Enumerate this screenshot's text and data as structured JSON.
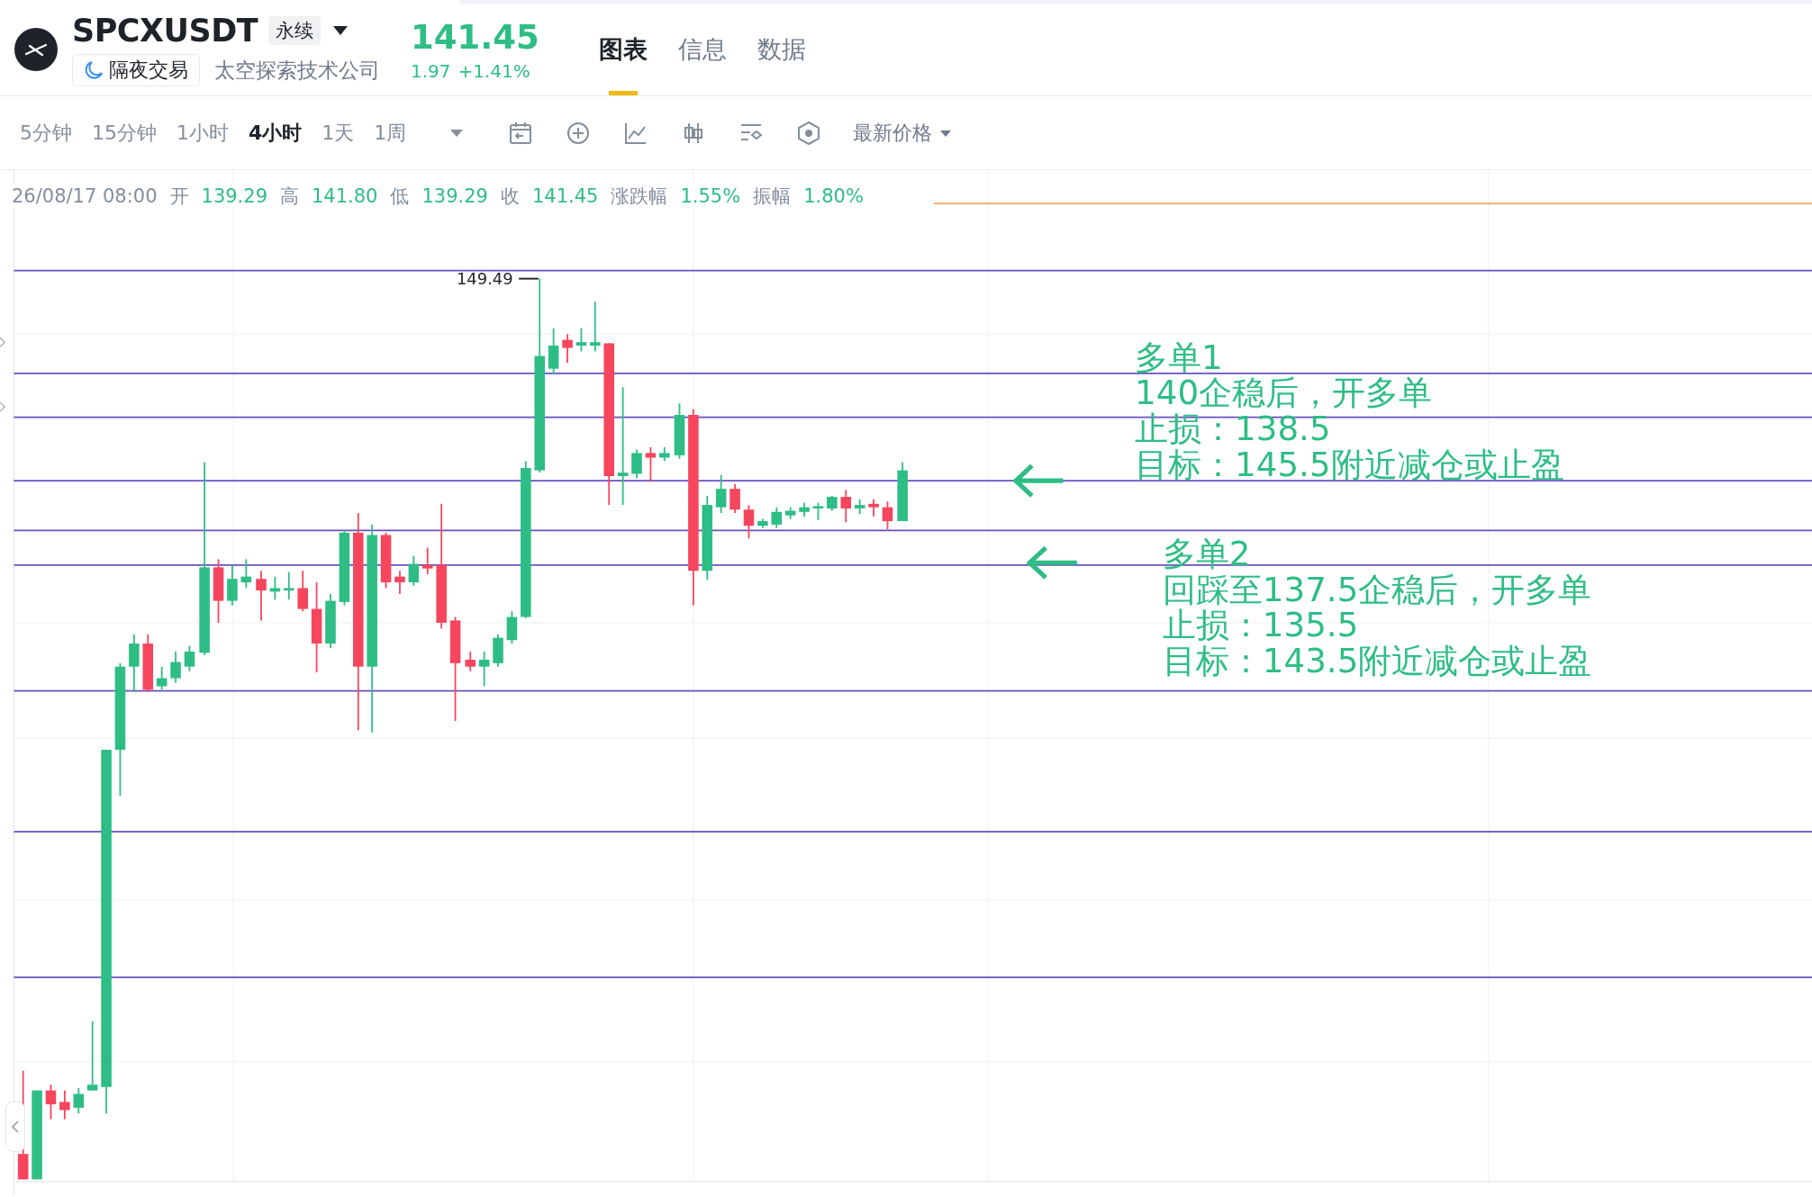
{
  "header": {
    "symbol": "SPCXUSDT",
    "contract_badge": "永续",
    "session_badge": "隔夜交易",
    "company": "太空探索技术公司",
    "price": "141.45",
    "change": "1.97",
    "change_percent": "+1.41%"
  },
  "tabs": [
    {
      "label": "图表",
      "selected": true
    },
    {
      "label": "信息",
      "selected": false
    },
    {
      "label": "数据",
      "selected": false
    }
  ],
  "intervals": [
    {
      "label": "5分钟",
      "selected": false
    },
    {
      "label": "15分钟",
      "selected": false
    },
    {
      "label": "1小时",
      "selected": false
    },
    {
      "label": "4小时",
      "selected": true
    },
    {
      "label": "1天",
      "selected": false
    },
    {
      "label": "1周",
      "selected": false
    }
  ],
  "price_source": "最新价格",
  "ohlc_bar": {
    "time": "26/08/17 08:00",
    "fields": [
      {
        "label": "开",
        "value": "139.29"
      },
      {
        "label": "高",
        "value": "141.80"
      },
      {
        "label": "低",
        "value": "139.29"
      },
      {
        "label": "收",
        "value": "141.45"
      },
      {
        "label": "涨跌幅",
        "value": "1.55%"
      },
      {
        "label": "振幅",
        "value": "1.80%"
      }
    ]
  },
  "chart": {
    "high_label": "149.49",
    "notes": [
      {
        "title": "多单1",
        "lines": [
          "140企稳后，开多单",
          "止损：138.5",
          "目标：145.5附近减仓或止盈"
        ]
      },
      {
        "title": "多单2",
        "lines": [
          "回踩至137.5企稳后，开多单",
          "止损：135.5",
          "目标：143.5附近减仓或止盈"
        ]
      }
    ]
  }
}
